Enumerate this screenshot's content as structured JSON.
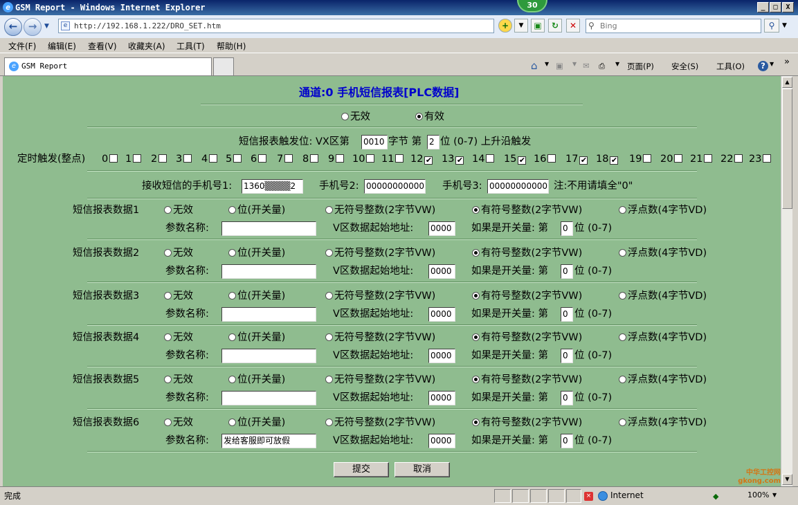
{
  "window": {
    "title": "GSM Report - Windows Internet Explorer",
    "badge": "30",
    "btn_min": "_",
    "btn_max": "□",
    "btn_close": "X"
  },
  "nav": {
    "address": "http://192.168.1.222/DRO_SET.htm",
    "search_placeholder": "Bing"
  },
  "menu": [
    "文件(F)",
    "编辑(E)",
    "查看(V)",
    "收藏夹(A)",
    "工具(T)",
    "帮助(H)"
  ],
  "tab": {
    "label": "GSM Report",
    "tools": [
      "页面(P)",
      "安全(S)",
      "工具(O)"
    ],
    "more": "»"
  },
  "page": {
    "title": "通道:0 手机短信报表[PLC数据]",
    "status_invalid": "无效",
    "status_valid": "有效",
    "trigger_prefix": "短信报表触发位:  VX区第",
    "trigger_byte": "0010",
    "trigger_mid": "字节 第",
    "trigger_bit": "2",
    "trigger_suffix": "位 (0-7) 上升沿触发",
    "timer_label": "定时触发(整点)",
    "hours": [
      {
        "h": "0",
        "c": false
      },
      {
        "h": "1",
        "c": false
      },
      {
        "h": "2",
        "c": false
      },
      {
        "h": "3",
        "c": false
      },
      {
        "h": "4",
        "c": false
      },
      {
        "h": "5",
        "c": false
      },
      {
        "h": "6",
        "c": false
      },
      {
        "h": "7",
        "c": false
      },
      {
        "h": "8",
        "c": false
      },
      {
        "h": "9",
        "c": false
      },
      {
        "h": "10",
        "c": false
      },
      {
        "h": "11",
        "c": false
      },
      {
        "h": "12",
        "c": true
      },
      {
        "h": "13",
        "c": true
      },
      {
        "h": "14",
        "c": false
      },
      {
        "h": "15",
        "c": true
      },
      {
        "h": "16",
        "c": false
      },
      {
        "h": "17",
        "c": true
      },
      {
        "h": "18",
        "c": true
      },
      {
        "h": "19",
        "c": false
      },
      {
        "h": "20",
        "c": false
      },
      {
        "h": "21",
        "c": false
      },
      {
        "h": "22",
        "c": false
      },
      {
        "h": "23",
        "c": false
      }
    ],
    "phone1_label": "接收短信的手机号1:",
    "phone1": "1360▒▒▒▒2",
    "phone2_label": "手机号2:",
    "phone2": "00000000000",
    "phone3_label": "手机号3:",
    "phone3": "00000000000",
    "phone_note": "注:不用请填全\"0\"",
    "opt_invalid": "无效",
    "opt_bit": "位(开关量)",
    "opt_unsigned": "无符号整数(2字节VW)",
    "opt_signed": "有符号整数(2字节VW)",
    "opt_float": "浮点数(4字节VD)",
    "param_label": "参数名称:",
    "addr_label": "V区数据起始地址:",
    "bit_prefix": "如果是开关量: 第",
    "bit_suffix": "位 (0-7)",
    "items": [
      {
        "label": "短信报表数据1",
        "name": "",
        "addr": "0000",
        "bit": "0"
      },
      {
        "label": "短信报表数据2",
        "name": "",
        "addr": "0000",
        "bit": "0"
      },
      {
        "label": "短信报表数据3",
        "name": "",
        "addr": "0000",
        "bit": "0"
      },
      {
        "label": "短信报表数据4",
        "name": "",
        "addr": "0000",
        "bit": "0"
      },
      {
        "label": "短信报表数据5",
        "name": "",
        "addr": "0000",
        "bit": "0"
      },
      {
        "label": "短信报表数据6",
        "name": "发给客服即可放假",
        "addr": "0000",
        "bit": "0"
      }
    ],
    "submit": "提交",
    "cancel": "取消"
  },
  "status": {
    "text": "完成",
    "zone": "Internet",
    "zoom": "100%",
    "watermark": "中华工控网 gkong.com"
  },
  "colors": {
    "page_bg": "#8fbc8f",
    "title_blue": "#0000cc",
    "titlebar": "#0a246a"
  }
}
